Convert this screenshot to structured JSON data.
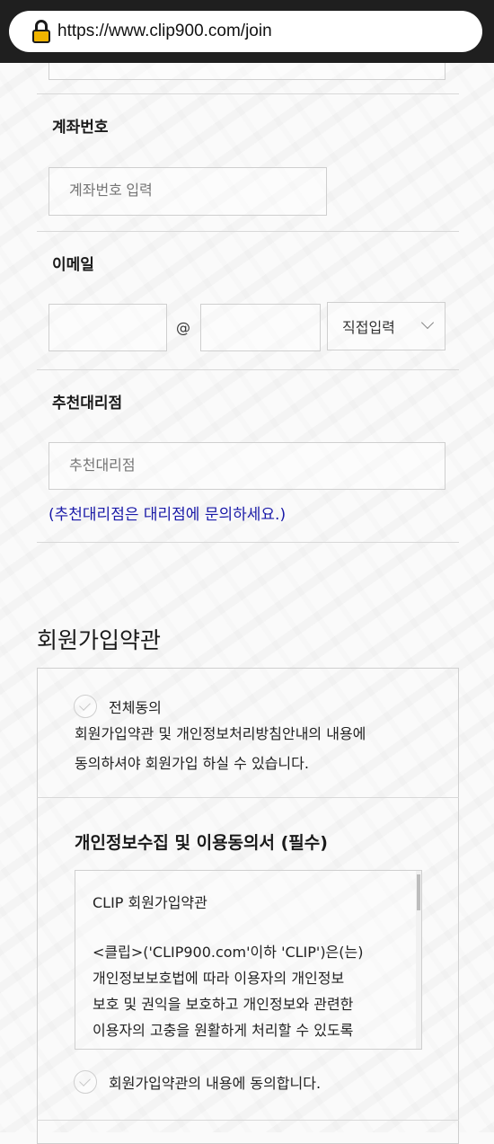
{
  "browser": {
    "url": "https://www.clip900.com/join"
  },
  "form": {
    "account": {
      "label": "계좌번호",
      "placeholder": "계좌번호 입력"
    },
    "email": {
      "label": "이메일",
      "at": "@",
      "select_value": "직접입력"
    },
    "referrer": {
      "label": "추천대리점",
      "placeholder": "추천대리점",
      "note": "(추천대리점은 대리점에 문의하세요.)"
    }
  },
  "terms": {
    "title": "회원가입약관",
    "agree_all": {
      "label": "전체동의",
      "desc_line1": "회원가입약관 및 개인정보처리방침안내의 내용에",
      "desc_line2": "동의하셔야 회원가입 하실 수 있습니다."
    },
    "privacy": {
      "title": "개인정보수집 및 이용동의서 (필수)",
      "box_title": "CLIP 회원가입약관",
      "box_lines": [
        "<클립>('CLIP900.com'이하 'CLIP')은(는)",
        "개인정보보호법에 따라 이용자의 개인정보",
        "보호 및 권익을 보호하고 개인정보와 관련한",
        "이용자의 고충을 원활하게 처리할 수 있도록"
      ],
      "agree_label": "회원가입약관의 내용에 동의합니다."
    }
  },
  "colors": {
    "note": "#1a1aa8",
    "topbar": "#1f1f1f",
    "lock": "#f0b400"
  }
}
